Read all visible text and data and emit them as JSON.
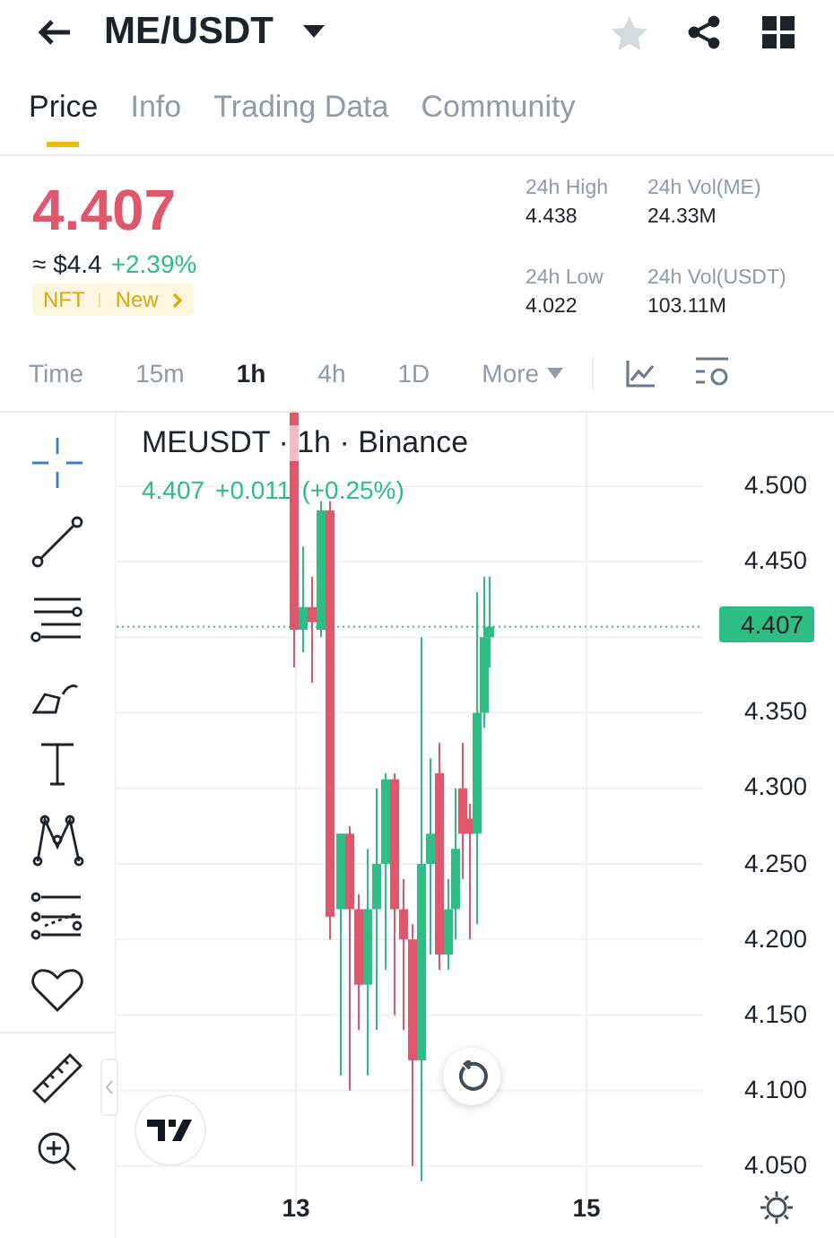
{
  "header": {
    "title": "ME/USDT"
  },
  "tabs": [
    {
      "label": "Price",
      "selected": true
    },
    {
      "label": "Info",
      "selected": false
    },
    {
      "label": "Trading Data",
      "selected": false
    },
    {
      "label": "Community",
      "selected": false
    }
  ],
  "price": {
    "last": "4.407",
    "usd": "≈ $4.4",
    "change": "+2.39%",
    "tags": [
      "NFT",
      "New"
    ]
  },
  "stats": [
    {
      "label": "24h High",
      "value": "4.438"
    },
    {
      "label": "24h Vol(ME)",
      "value": "24.33M"
    },
    {
      "label": "24h Low",
      "value": "4.022"
    },
    {
      "label": "24h Vol(USDT)",
      "value": "103.11M"
    }
  ],
  "intervals": [
    {
      "label": "Time",
      "selected": false
    },
    {
      "label": "15m",
      "selected": false
    },
    {
      "label": "1h",
      "selected": true
    },
    {
      "label": "4h",
      "selected": false
    },
    {
      "label": "1D",
      "selected": false
    },
    {
      "label": "More",
      "selected": false
    }
  ],
  "chart": {
    "title": "MEUSDT · 1h · Binance",
    "last": "4.407",
    "change": "+0.011",
    "change_pct": "(+0.25%)",
    "price_tag": "4.407",
    "y_labels": [
      "4.500",
      "4.450",
      "4.350",
      "4.300",
      "4.250",
      "4.200",
      "4.150",
      "4.100",
      "4.050"
    ],
    "x_labels": [
      "13",
      "15"
    ]
  }
}
